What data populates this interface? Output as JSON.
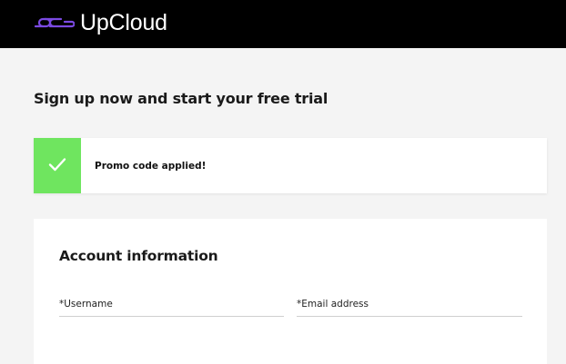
{
  "header": {
    "logo_text": "UpCloud",
    "logo_icon": "upcloud-logo-icon",
    "logo_color": "#7b4ae2"
  },
  "page": {
    "heading": "Sign up now and start your free trial"
  },
  "promo": {
    "message": "Promo code applied!",
    "icon": "checkmark-icon",
    "accent_color": "#6fe55f"
  },
  "account": {
    "title": "Account information",
    "username_label": "*Username",
    "email_label": "*Email address"
  }
}
